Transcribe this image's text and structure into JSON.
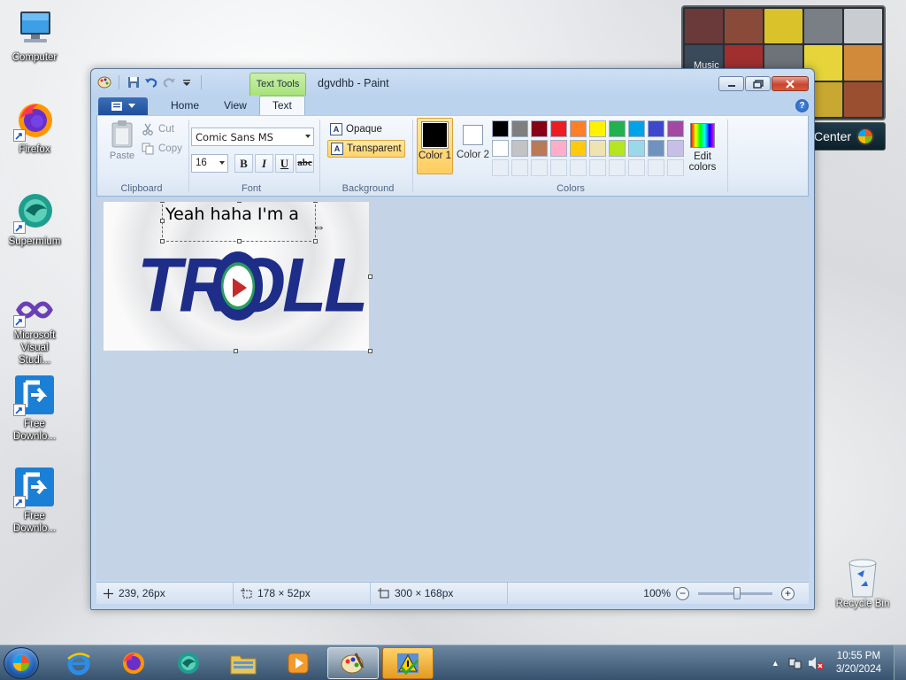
{
  "desktop": {
    "icons": [
      {
        "label": "Computer"
      },
      {
        "label": "Firefox"
      },
      {
        "label": "Supermium"
      },
      {
        "label": "Microsoft Visual Studi..."
      },
      {
        "label": "Free Downlo..."
      },
      {
        "label": "Free Downlo..."
      }
    ],
    "recycle_bin": "Recycle Bin",
    "gadget_label": "Music",
    "media_center_label": "Center"
  },
  "paint": {
    "contextual_tab": "Text Tools",
    "title": "dgvdhb - Paint",
    "tabs": [
      "Home",
      "View",
      "Text"
    ],
    "active_tab": "Text",
    "clipboard": {
      "paste": "Paste",
      "cut": "Cut",
      "copy": "Copy",
      "label": "Clipboard"
    },
    "font": {
      "family": "Comic Sans MS",
      "size": "16",
      "bold": "B",
      "italic": "I",
      "underline": "U",
      "strikethrough": "abc",
      "label": "Font"
    },
    "background": {
      "opaque": "Opaque",
      "transparent": "Transparent",
      "selected": "Transparent",
      "label": "Background"
    },
    "colors": {
      "color1_label": "Color 1",
      "color1_value": "#000000",
      "color2_label": "Color 2",
      "color2_value": "#ffffff",
      "edit_colors": "Edit colors",
      "label": "Colors",
      "palette_row1": [
        "#000000",
        "#7f7f7f",
        "#880015",
        "#ed1c24",
        "#ff7f27",
        "#fff200",
        "#22b14c",
        "#00a2e8",
        "#3f48cc",
        "#a349a4"
      ],
      "palette_row2": [
        "#ffffff",
        "#c3c3c3",
        "#b97a57",
        "#ffaec9",
        "#ffc90e",
        "#efe4b0",
        "#b5e61d",
        "#99d9ea",
        "#7092be",
        "#c8bfe7"
      ]
    },
    "canvas": {
      "text_box_content": "Yeah haha I'm a",
      "image_text": "TROLL"
    },
    "status": {
      "cursor_position": "239, 26px",
      "selection_size": "178 × 52px",
      "image_size": "300 × 168px",
      "zoom": "100%"
    }
  },
  "taskbar": {
    "time": "10:55 PM",
    "date": "3/20/2024"
  }
}
